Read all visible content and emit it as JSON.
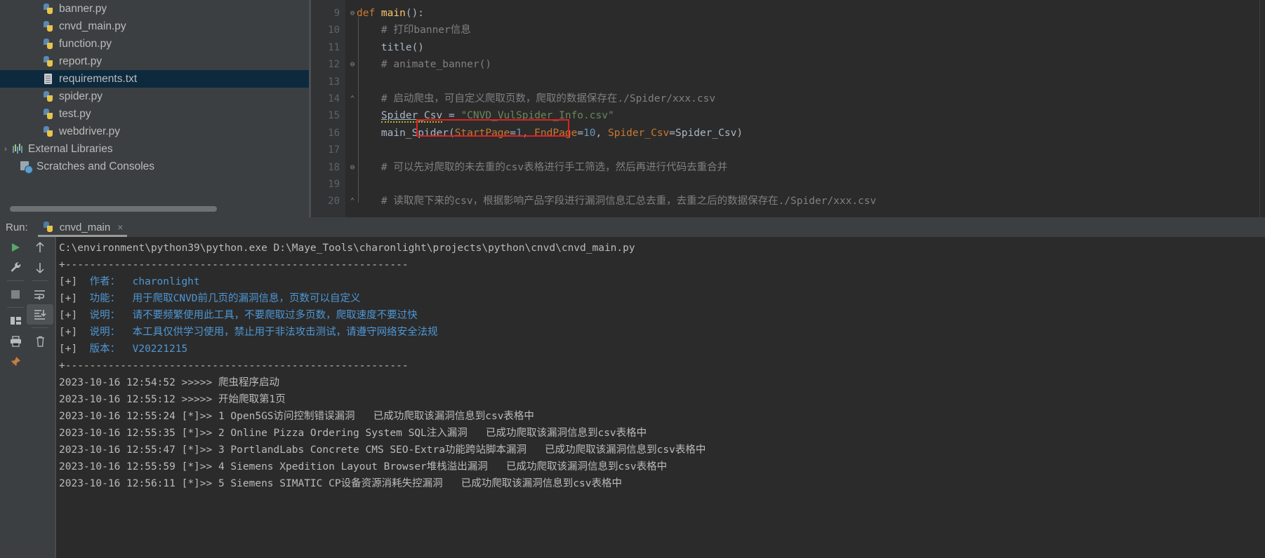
{
  "project_tree": {
    "items": [
      {
        "label": "banner.py",
        "icon": "python-file-icon",
        "indent": 60,
        "selected": false,
        "arrow": ""
      },
      {
        "label": "cnvd_main.py",
        "icon": "python-file-icon",
        "indent": 60,
        "selected": false,
        "arrow": ""
      },
      {
        "label": "function.py",
        "icon": "python-file-icon",
        "indent": 60,
        "selected": false,
        "arrow": ""
      },
      {
        "label": "report.py",
        "icon": "python-file-icon",
        "indent": 60,
        "selected": false,
        "arrow": ""
      },
      {
        "label": "requirements.txt",
        "icon": "text-file-icon",
        "indent": 60,
        "selected": true,
        "arrow": ""
      },
      {
        "label": "spider.py",
        "icon": "python-file-icon",
        "indent": 60,
        "selected": false,
        "arrow": ""
      },
      {
        "label": "test.py",
        "icon": "python-file-icon",
        "indent": 60,
        "selected": false,
        "arrow": ""
      },
      {
        "label": "webdriver.py",
        "icon": "python-file-icon",
        "indent": 60,
        "selected": false,
        "arrow": ""
      },
      {
        "label": "External Libraries",
        "icon": "libraries-icon",
        "indent": 14,
        "selected": false,
        "arrow": "›"
      },
      {
        "label": "Scratches and Consoles",
        "icon": "scratches-icon",
        "indent": 28,
        "selected": false,
        "arrow": ""
      }
    ]
  },
  "editor": {
    "lines": [
      {
        "num": "9",
        "fold": "⊖",
        "indent": 0,
        "segments": [
          {
            "t": "def ",
            "c": "c-kw"
          },
          {
            "t": "main",
            "c": "c-fn"
          },
          {
            "t": "():",
            "c": "c-def"
          }
        ]
      },
      {
        "num": "10",
        "fold": "",
        "indent": 0,
        "segments": [
          {
            "t": "    # 打印banner信息",
            "c": "c-cmt"
          }
        ]
      },
      {
        "num": "11",
        "fold": "",
        "indent": 0,
        "segments": [
          {
            "t": "    title()",
            "c": "c-def"
          }
        ]
      },
      {
        "num": "12",
        "fold": "⊖",
        "indent": 0,
        "segments": [
          {
            "t": "    # animate_banner()",
            "c": "c-cmt"
          }
        ]
      },
      {
        "num": "13",
        "fold": "",
        "indent": 0,
        "segments": [
          {
            "t": "",
            "c": "c-def"
          }
        ]
      },
      {
        "num": "14",
        "fold": "⌃",
        "indent": 0,
        "segments": [
          {
            "t": "    # 启动爬虫，可自定义爬取页数，爬取的数据保存在./Spider/xxx.csv",
            "c": "c-cmt"
          }
        ]
      },
      {
        "num": "15",
        "fold": "",
        "indent": 0,
        "segments": [
          {
            "t": "    ",
            "c": "c-def"
          },
          {
            "t": "Spider_Csv",
            "c": "c-def squiggle underline-var"
          },
          {
            "t": " = ",
            "c": "c-def"
          },
          {
            "t": "\"CNVD_VulSpider_Info.csv\"",
            "c": "c-str"
          }
        ]
      },
      {
        "num": "16",
        "fold": "",
        "indent": 0,
        "segments": [
          {
            "t": "    main_Spider(",
            "c": "c-def"
          },
          {
            "t": "StartPage",
            "c": "c-param"
          },
          {
            "t": "=",
            "c": "c-def"
          },
          {
            "t": "1",
            "c": "c-num"
          },
          {
            "t": ", ",
            "c": "c-def"
          },
          {
            "t": "EndPage",
            "c": "c-param"
          },
          {
            "t": "=",
            "c": "c-def"
          },
          {
            "t": "10",
            "c": "c-num"
          },
          {
            "t": ", ",
            "c": "c-def"
          },
          {
            "t": "Spider_Csv",
            "c": "c-param"
          },
          {
            "t": "=",
            "c": "c-def"
          },
          {
            "t": "Spider_Csv)",
            "c": "c-def"
          }
        ]
      },
      {
        "num": "17",
        "fold": "",
        "indent": 0,
        "segments": [
          {
            "t": "",
            "c": "c-def"
          }
        ]
      },
      {
        "num": "18",
        "fold": "⊖",
        "indent": 0,
        "segments": [
          {
            "t": "    # 可以先对爬取的未去重的csv表格进行手工筛选，然后再进行代码去重合并",
            "c": "c-cmt"
          }
        ]
      },
      {
        "num": "19",
        "fold": "",
        "indent": 0,
        "segments": [
          {
            "t": "",
            "c": "c-def"
          }
        ]
      },
      {
        "num": "20",
        "fold": "⌃",
        "indent": 0,
        "segments": [
          {
            "t": "    # 读取爬下来的csv，根据影响产品字段进行漏洞信息汇总去重，去重之后的数据保存在./Spider/xxx.csv",
            "c": "c-cmt"
          }
        ]
      }
    ],
    "highlight_box_label": "StartPage=1, EndPage=10,"
  },
  "run_panel": {
    "run_label": "Run:",
    "tab_name": "cnvd_main",
    "tab_close": "×",
    "toolbar_left": [
      {
        "name": "rerun-button",
        "icon": "play-icon"
      },
      {
        "name": "settings-button",
        "icon": "wrench-icon"
      },
      {
        "name": "stop-button",
        "icon": "stop-icon"
      },
      {
        "name": "layout-button",
        "icon": "layout-icon"
      },
      {
        "name": "print-button",
        "icon": "printer-icon"
      },
      {
        "name": "pin-button",
        "icon": "pin-icon"
      }
    ],
    "toolbar_right": [
      {
        "name": "up-stack-button",
        "icon": "arrow-up-icon"
      },
      {
        "name": "down-stack-button",
        "icon": "arrow-down-icon"
      },
      {
        "name": "soft-wrap-button",
        "icon": "wrap-icon"
      },
      {
        "name": "scroll-to-end-button",
        "icon": "scroll-end-icon"
      },
      {
        "name": "clear-all-button",
        "icon": "trash-icon"
      }
    ]
  },
  "console": {
    "lines": [
      {
        "segments": [
          {
            "t": "C:\\environment\\python39\\python.exe D:\\Maye_Tools\\charonlight\\projects\\python\\cnvd\\cnvd_main.py",
            "c": "con-grey"
          }
        ]
      },
      {
        "segments": [
          {
            "t": "+--------------------------------------------------------",
            "c": "con-grey"
          }
        ]
      },
      {
        "segments": [
          {
            "t": "[+]  ",
            "c": "con-grey"
          },
          {
            "t": "作者：  charonlight",
            "c": "con-blue"
          }
        ]
      },
      {
        "segments": [
          {
            "t": "[+]  ",
            "c": "con-grey"
          },
          {
            "t": "功能：  用于爬取CNVD前几页的漏洞信息，页数可以自定义",
            "c": "con-blue"
          }
        ]
      },
      {
        "segments": [
          {
            "t": "[+]  ",
            "c": "con-grey"
          },
          {
            "t": "说明：  请不要频繁使用此工具，不要爬取过多页数，爬取速度不要过快",
            "c": "con-blue"
          }
        ]
      },
      {
        "segments": [
          {
            "t": "[+]  ",
            "c": "con-grey"
          },
          {
            "t": "说明：  本工具仅供学习使用，禁止用于非法攻击测试，请遵守网络安全法规",
            "c": "con-blue"
          }
        ]
      },
      {
        "segments": [
          {
            "t": "[+]  ",
            "c": "con-grey"
          },
          {
            "t": "版本：  V20221215",
            "c": "con-blue"
          }
        ]
      },
      {
        "segments": [
          {
            "t": "+--------------------------------------------------------",
            "c": "con-grey"
          }
        ]
      },
      {
        "segments": [
          {
            "t": "2023-10-16 12:54:52 >>>>> 爬虫程序启动",
            "c": "con-grey"
          }
        ]
      },
      {
        "segments": [
          {
            "t": "2023-10-16 12:55:12 >>>>> 开始爬取第1页",
            "c": "con-grey"
          }
        ]
      },
      {
        "segments": [
          {
            "t": "2023-10-16 12:55:24 [*]>> 1 Open5GS访问控制错误漏洞   已成功爬取该漏洞信息到csv表格中",
            "c": "con-grey"
          }
        ]
      },
      {
        "segments": [
          {
            "t": "2023-10-16 12:55:35 [*]>> 2 Online Pizza Ordering System SQL注入漏洞   已成功爬取该漏洞信息到csv表格中",
            "c": "con-grey"
          }
        ]
      },
      {
        "segments": [
          {
            "t": "2023-10-16 12:55:47 [*]>> 3 PortlandLabs Concrete CMS SEO-Extra功能跨站脚本漏洞   已成功爬取该漏洞信息到csv表格中",
            "c": "con-grey"
          }
        ]
      },
      {
        "segments": [
          {
            "t": "2023-10-16 12:55:59 [*]>> 4 Siemens Xpedition Layout Browser堆栈溢出漏洞   已成功爬取该漏洞信息到csv表格中",
            "c": "con-grey"
          }
        ]
      },
      {
        "segments": [
          {
            "t": "2023-10-16 12:56:11 [*]>> 5 Siemens SIMATIC CP设备资源消耗失控漏洞   已成功爬取该漏洞信息到csv表格中",
            "c": "con-grey"
          }
        ]
      }
    ]
  },
  "colors": {
    "background": "#3c3f41",
    "editor_bg": "#2b2b2b",
    "selection": "#0d293e",
    "accent_red": "#e02020",
    "console_blue": "#4e97d4"
  }
}
